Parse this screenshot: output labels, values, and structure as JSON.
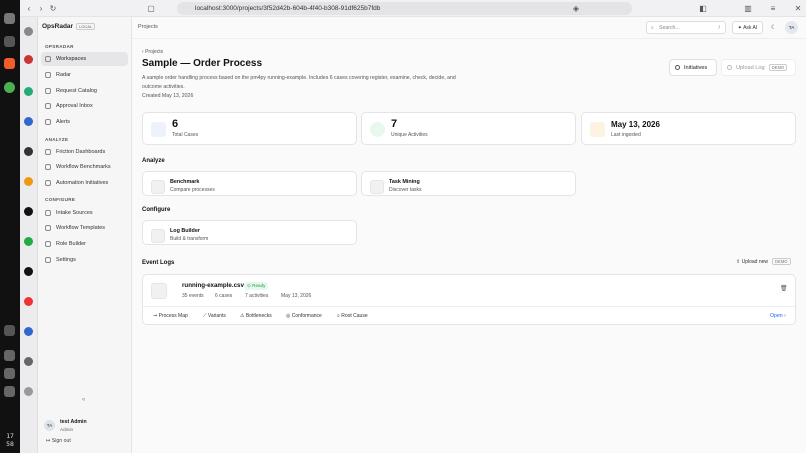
{
  "browser": {
    "url": "localhost:3000/projects/3f52d42b-604b-4f40-b308-91df625b7fdb"
  },
  "clock": {
    "hour": "17",
    "minute": "58"
  },
  "brand": {
    "name": "OpsRadar",
    "badge": "LOCAL"
  },
  "sidebar": {
    "section_main": "OPSRADAR",
    "section_analyze": "ANALYZE",
    "section_configure": "CONFIGURE",
    "items": [
      {
        "label": "Workspaces"
      },
      {
        "label": "Radar"
      },
      {
        "label": "Request Catalog"
      },
      {
        "label": "Approval Inbox"
      },
      {
        "label": "Alerts"
      },
      {
        "label": "Friction Dashboards"
      },
      {
        "label": "Workflow Benchmarks"
      },
      {
        "label": "Automation Initiatives"
      },
      {
        "label": "Intake Sources"
      },
      {
        "label": "Workflow Templates"
      },
      {
        "label": "Role Builder"
      },
      {
        "label": "Settings"
      }
    ],
    "collapse": "«",
    "user": {
      "initials": "TA",
      "name": "test Admin",
      "role": "Admin"
    },
    "signout": "Sign out"
  },
  "header": {
    "breadcrumb": "Projects",
    "search_placeholder": "Search...",
    "search_shortcut": "/",
    "ask_ai": "Ask AI",
    "initials": "TA"
  },
  "page": {
    "back": "Projects",
    "title": "Sample — Order Process",
    "description": "A sample order handling process based on the pm4py running-example. Includes 6 cases covering register, examine, check, decide, and outcome activities.",
    "created": "Created May 13, 2026",
    "initiatives_label": "Initiatives",
    "upload_log_label": "Upload Log",
    "demo_badge": "DEMO"
  },
  "stats": [
    {
      "value": "6",
      "label": "Total Cases"
    },
    {
      "value": "7",
      "label": "Unique Activities"
    },
    {
      "value": "May 13, 2026",
      "label": "Last ingested"
    }
  ],
  "analyze": {
    "heading": "Analyze",
    "cards": [
      {
        "title": "Benchmark",
        "sub": "Compare processes"
      },
      {
        "title": "Task Mining",
        "sub": "Discover tasks"
      }
    ]
  },
  "configure": {
    "heading": "Configure",
    "cards": [
      {
        "title": "Log Builder",
        "sub": "Build & transform"
      }
    ]
  },
  "event_logs": {
    "heading": "Event Logs",
    "upload_new": "Upload new",
    "demo_badge": "DEMO",
    "log": {
      "name": "running-example.csv",
      "status": "Ready",
      "events": "35 events",
      "cases": "6 cases",
      "activities": "7 activities",
      "date": "May 13, 2026"
    },
    "actions": [
      "Process Map",
      "Variants",
      "Bottlenecks",
      "Conformance",
      "Root Cause"
    ],
    "open": "Open"
  },
  "colors": {
    "accent": "#2563eb",
    "ready": "#16a34a"
  }
}
